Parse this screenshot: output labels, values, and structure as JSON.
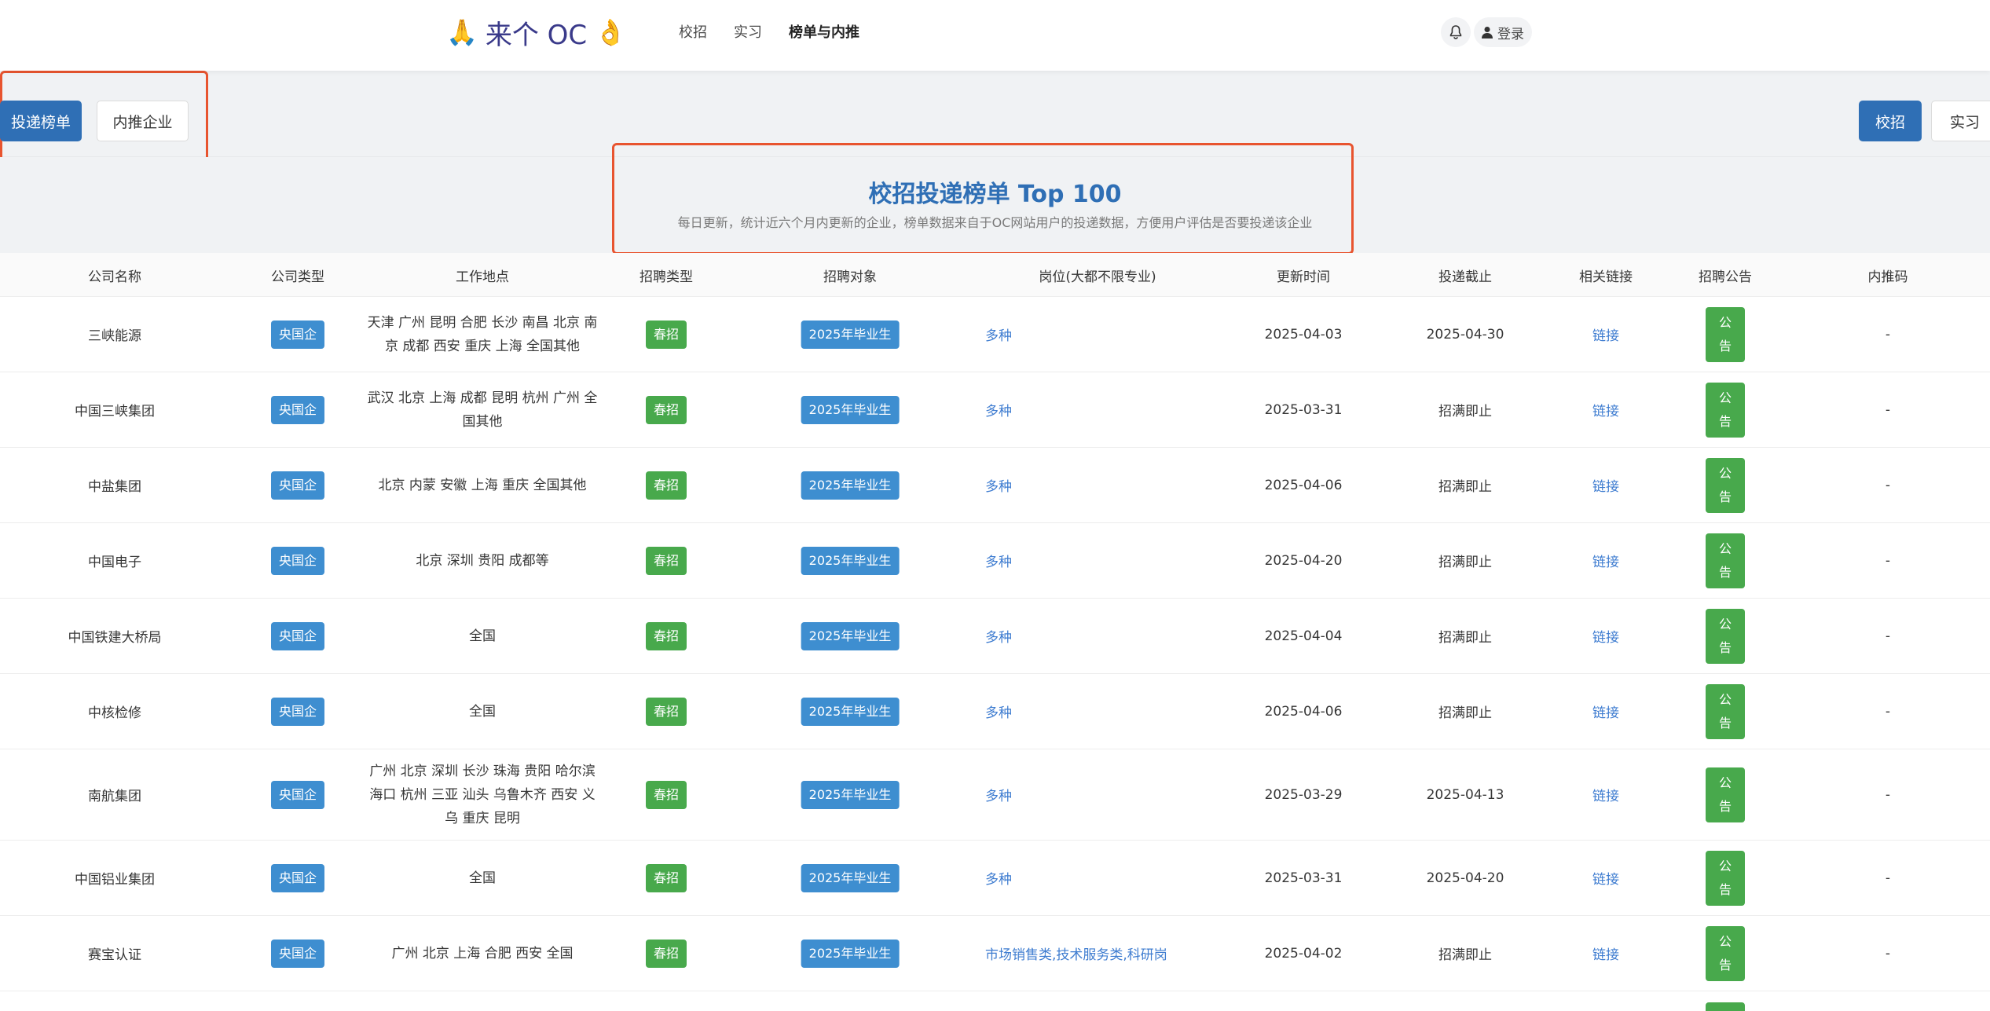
{
  "nav": {
    "brand_text": "来个 OC",
    "brand_left_emoji": "🙏",
    "brand_right_emoji": "👌",
    "links": [
      "校招",
      "实习",
      "榜单与内推"
    ],
    "active_link": "榜单与内推",
    "login_label": "登录"
  },
  "tabs": {
    "left": [
      "投递榜单",
      "内推企业"
    ],
    "right": [
      "校招",
      "实习"
    ]
  },
  "hero": {
    "title": "校招投递榜单 Top 100",
    "subtitle": "每日更新，统计近六个月内更新的企业，榜单数据来自于OC网站用户的投递数据，方便用户评估是否要投递该企业"
  },
  "table": {
    "headers": [
      "公司名称",
      "公司类型",
      "工作地点",
      "招聘类型",
      "招聘对象",
      "岗位(大都不限专业)",
      "更新时间",
      "投递截止",
      "相关链接",
      "招聘公告",
      "内推码"
    ],
    "rows": [
      {
        "company": "三峡能源",
        "type": "央国企",
        "location": "天津 广州 昆明 合肥 长沙 南昌 北京 南京 成都 西安 重庆 上海 全国其他",
        "recruit": "春招",
        "target": "2025年毕业生",
        "position": "多种",
        "updated": "2025-04-03",
        "deadline": "2025-04-30",
        "link": "链接",
        "notice": [
          "公",
          "告"
        ],
        "code": "-"
      },
      {
        "company": "中国三峡集团",
        "type": "央国企",
        "location": "武汉 北京 上海 成都 昆明 杭州 广州 全国其他",
        "recruit": "春招",
        "target": "2025年毕业生",
        "position": "多种",
        "updated": "2025-03-31",
        "deadline": "招满即止",
        "link": "链接",
        "notice": [
          "公",
          "告"
        ],
        "code": "-"
      },
      {
        "company": "中盐集团",
        "type": "央国企",
        "location": "北京 内蒙 安徽 上海 重庆 全国其他",
        "recruit": "春招",
        "target": "2025年毕业生",
        "position": "多种",
        "updated": "2025-04-06",
        "deadline": "招满即止",
        "link": "链接",
        "notice": [
          "公",
          "告"
        ],
        "code": "-"
      },
      {
        "company": "中国电子",
        "type": "央国企",
        "location": "北京 深圳 贵阳 成都等",
        "recruit": "春招",
        "target": "2025年毕业生",
        "position": "多种",
        "updated": "2025-04-20",
        "deadline": "招满即止",
        "link": "链接",
        "notice": [
          "公",
          "告"
        ],
        "code": "-"
      },
      {
        "company": "中国铁建大桥局",
        "type": "央国企",
        "location": "全国",
        "recruit": "春招",
        "target": "2025年毕业生",
        "position": "多种",
        "updated": "2025-04-04",
        "deadline": "招满即止",
        "link": "链接",
        "notice": [
          "公",
          "告"
        ],
        "code": "-"
      },
      {
        "company": "中核检修",
        "type": "央国企",
        "location": "全国",
        "recruit": "春招",
        "target": "2025年毕业生",
        "position": "多种",
        "updated": "2025-04-06",
        "deadline": "招满即止",
        "link": "链接",
        "notice": [
          "公",
          "告"
        ],
        "code": "-"
      },
      {
        "company": "南航集团",
        "type": "央国企",
        "location": "广州 北京 深圳 长沙 珠海 贵阳 哈尔滨 海口 杭州 三亚 汕头 乌鲁木齐 西安 义乌 重庆 昆明",
        "recruit": "春招",
        "target": "2025年毕业生",
        "position": "多种",
        "updated": "2025-03-29",
        "deadline": "2025-04-13",
        "link": "链接",
        "notice": [
          "公",
          "告"
        ],
        "code": "-"
      },
      {
        "company": "中国铝业集团",
        "type": "央国企",
        "location": "全国",
        "recruit": "春招",
        "target": "2025年毕业生",
        "position": "多种",
        "updated": "2025-03-31",
        "deadline": "2025-04-20",
        "link": "链接",
        "notice": [
          "公",
          "告"
        ],
        "code": "-"
      },
      {
        "company": "赛宝认证",
        "type": "央国企",
        "location": "广州 北京 上海 合肥 西安 全国",
        "recruit": "春招",
        "target": "2025年毕业生",
        "position": "市场销售类,技术服务类,科研岗",
        "updated": "2025-04-02",
        "deadline": "招满即止",
        "link": "链接",
        "notice": [
          "公",
          "告"
        ],
        "code": "-"
      }
    ]
  }
}
